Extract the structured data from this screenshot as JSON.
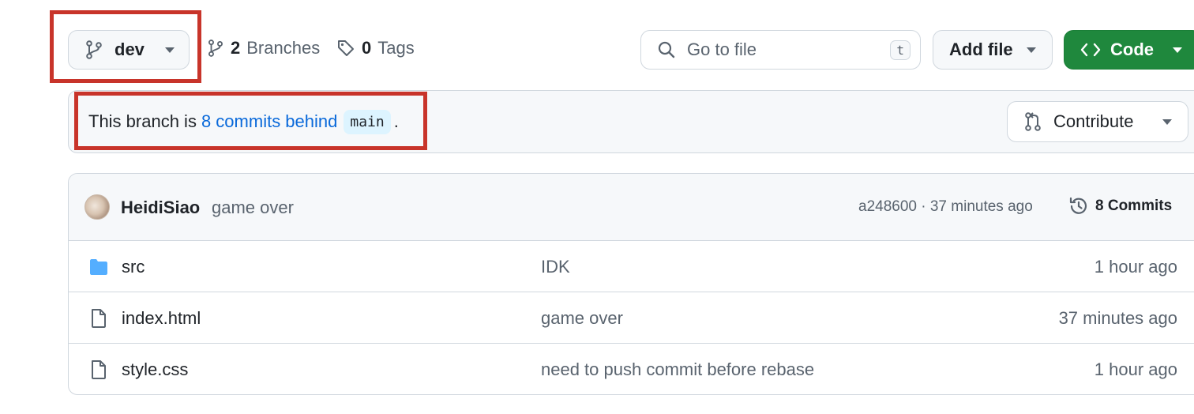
{
  "toolbar": {
    "branch_name": "dev",
    "branches_count": "2",
    "branches_label": "Branches",
    "tags_count": "0",
    "tags_label": "Tags",
    "search_placeholder": "Go to file",
    "search_shortcut": "t",
    "add_file_label": "Add file",
    "code_label": "Code"
  },
  "banner": {
    "prefix": "This branch is",
    "link_text": "8 commits behind",
    "base_branch": "main",
    "suffix": ".",
    "contribute_label": "Contribute"
  },
  "latest_commit": {
    "author": "HeidiSiao",
    "message": "game over",
    "meta": "a248600 · 37 minutes ago",
    "commits_label": "8 Commits"
  },
  "files": [
    {
      "type": "folder",
      "name": "src",
      "message": "IDK",
      "time": "1 hour ago"
    },
    {
      "type": "file",
      "name": "index.html",
      "message": "game over",
      "time": "37 minutes ago"
    },
    {
      "type": "file",
      "name": "style.css",
      "message": "need to push commit before rebase",
      "time": "1 hour ago"
    }
  ],
  "icons": {
    "branch": "git-branch-icon",
    "tag": "tag-icon",
    "search": "search-icon",
    "code": "code-icon",
    "pull_request": "git-pull-request-icon",
    "history": "history-icon",
    "folder": "folder-icon",
    "file": "file-icon"
  },
  "colors": {
    "accent_green": "#1f883d",
    "link_blue": "#0969da",
    "folder_blue": "#54aeff",
    "highlight_red": "#c8342a"
  }
}
